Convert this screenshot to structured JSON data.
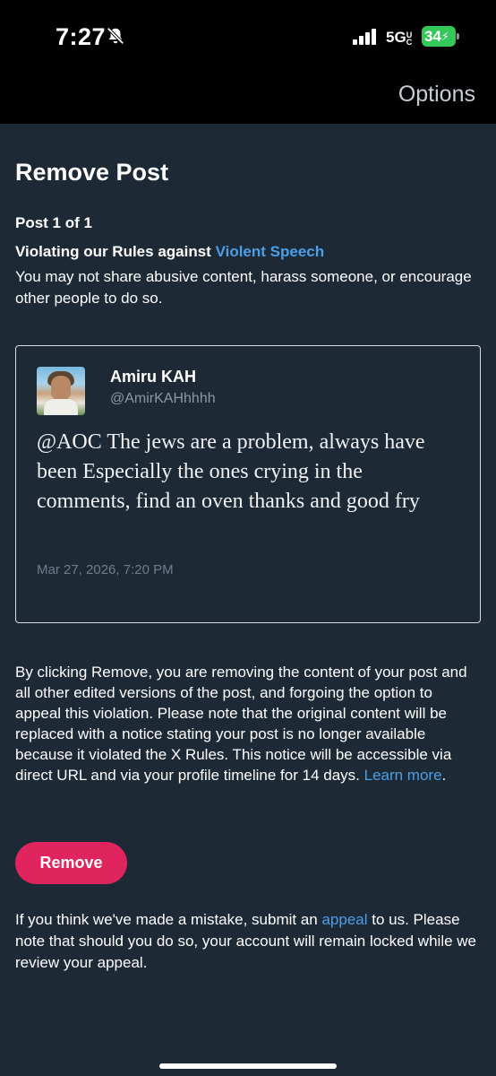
{
  "status_bar": {
    "time": "7:27",
    "network": "5G",
    "network_suffix": "UC",
    "battery": "34"
  },
  "header": {
    "options_label": "Options"
  },
  "page": {
    "title": "Remove Post",
    "post_count": "Post 1 of 1",
    "violation_prefix": "Violating our Rules against ",
    "violation_link": "Violent Speech",
    "violation_desc": "You may not share abusive content, harass someone, or encourage other people to do so."
  },
  "post": {
    "author_name": "Amiru KAH",
    "author_handle": "@AmirKAHhhhh",
    "text": "@AOC The jews are a problem, always have been Especially the ones crying in the comments, find an oven thanks and good fry",
    "date": "Mar 27, 2026, 7:20 PM"
  },
  "removal": {
    "info": "By clicking Remove, you are removing the content of your post and all other edited versions of the post, and forgoing the option to appeal this violation. Please note that the original content will be replaced with a notice stating your post is no longer available because it violated the X Rules. This notice will be accessible via direct URL and via your profile timeline for 14 days. ",
    "learn_more": "Learn more",
    "info_end": ".",
    "button_label": "Remove"
  },
  "appeal": {
    "prefix": "If you think we've made a mistake, submit an ",
    "link": "appeal",
    "suffix": " to us. Please note that should you do so, your account will remain locked while we review your appeal."
  },
  "colors": {
    "accent": "#4a9fe8",
    "remove": "#e0245e",
    "background": "#1d2935",
    "battery": "#34c759"
  },
  "icons": [
    "bell-slash-icon",
    "signal-bars-icon",
    "battery-icon"
  ]
}
